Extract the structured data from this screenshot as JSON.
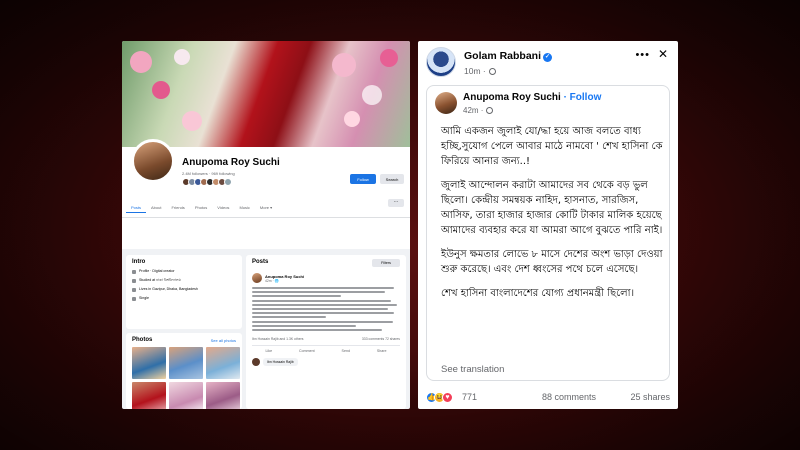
{
  "colors": {
    "fb_blue": "#1877f2",
    "background_red": "#5a1010",
    "text_primary": "#050505",
    "text_secondary": "#65676b"
  },
  "left_profile": {
    "name": "Anupoma Roy Suchi",
    "stats": "2.4M followers · 969 following",
    "follow_button": "Follow",
    "search_button": "Search",
    "tabs": [
      "Posts",
      "About",
      "Friends",
      "Photos",
      "Videos",
      "Music",
      "More ▾"
    ],
    "more_icon": "ellipsis-icon",
    "intro": {
      "title": "Intro",
      "rows": [
        {
          "icon": "info-icon",
          "text": "Profile · Digital creator"
        },
        {
          "icon": "school-icon",
          "text": "Studied at ঢাকা বিশ্ববিদ্যালয়"
        },
        {
          "icon": "home-icon",
          "text": "Lives in Gazipur, Dhaka, Bangladesh"
        },
        {
          "icon": "heart-icon",
          "text": "Single"
        }
      ]
    },
    "photos": {
      "title": "Photos",
      "see_all": "See all photos"
    },
    "posts": {
      "title": "Posts",
      "filters": "Filters",
      "post_author": "Anupoma Roy Suchi",
      "post_time": "42m · 🌐",
      "reaction_summary": "Ibn Hossain Rajib and 1.3K others",
      "comment_summary": "333 comments  72 shares",
      "actions": [
        "Like",
        "Comment",
        "Send",
        "Share"
      ],
      "comment_author": "Ibn Hossain Rajib"
    }
  },
  "shared_post": {
    "sharer_name": "Golam Rabbani",
    "sharer_time": "10m ·",
    "original_author": "Anupoma Roy Suchi",
    "follow_label": "· Follow",
    "original_time": "42m ·",
    "paragraphs": [
      "আমি একজন জুলাই যো/দ্ধা হয়ে আজ বলতে বাধ্য হচ্ছি,সুযোগ পেলে আবার মাঠে নামবো ' শেখ হাসিনা কে ফিরিয়ে আনার জন্য..!",
      "জুলাই আন্দোলন করাটা আমাদের সব থেকে বড় ভুল ছিলো। কেন্দ্রীয় সমন্বয়ক নাহিদ, হাসনাত, সারজিস, আসিফ, তারা হাজার হাজার কোটি টাকার মালিক হয়েছে আমাদের ব্যবহার করে যা আমরা আগে বুঝতে পারি নাই।",
      "ইউনুস ক্ষমতার লোভে ৮ মাসে দেশের অংশ ভাড়া দেওয়া শুরু করেছে। এবং দেশ ধ্বংসের পথে চলে এসেছে।",
      "শেখ হাসিনা বাংলাদেশের যোগ্য প্রধানমন্ত্রী ছিলো।"
    ],
    "see_translation": "See translation",
    "reaction_count": "771",
    "comments_count": "88 comments",
    "shares_count": "25 shares"
  }
}
